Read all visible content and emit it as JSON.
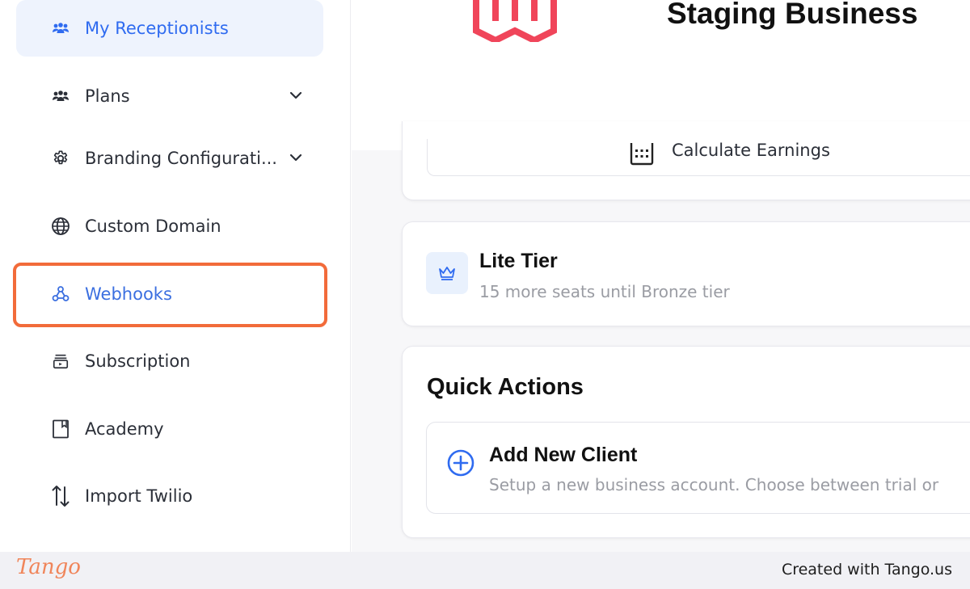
{
  "sidebar": {
    "items": [
      {
        "label": "My Receptionists",
        "icon": "users-icon",
        "active": true
      },
      {
        "label": "Plans",
        "icon": "users-icon",
        "expandable": true
      },
      {
        "label": "Branding Configurati...",
        "icon": "gear-icon",
        "expandable": true
      },
      {
        "label": "Custom Domain",
        "icon": "globe-icon"
      },
      {
        "label": "Webhooks",
        "icon": "webhook-icon",
        "highlighted": true
      },
      {
        "label": "Subscription",
        "icon": "subscription-icon"
      },
      {
        "label": "Academy",
        "icon": "book-icon"
      },
      {
        "label": "Import Twilio",
        "icon": "swap-vertical-icon"
      }
    ]
  },
  "header": {
    "business_name": "Staging Business"
  },
  "earnings": {
    "button_label": "Calculate Earnings"
  },
  "tier": {
    "title": "Lite Tier",
    "subtitle": "15 more seats until Bronze tier"
  },
  "quick_actions": {
    "title": "Quick Actions",
    "items": [
      {
        "title": "Add New Client",
        "description": "Setup a new business account. Choose between trial or"
      }
    ]
  },
  "footer": {
    "brand": "Tango",
    "created_text": "Created with Tango.us"
  },
  "colors": {
    "accent": "#2f6bf0",
    "highlight": "#f26b3a",
    "logo": "#f0455a",
    "tango": "#f0855a"
  }
}
